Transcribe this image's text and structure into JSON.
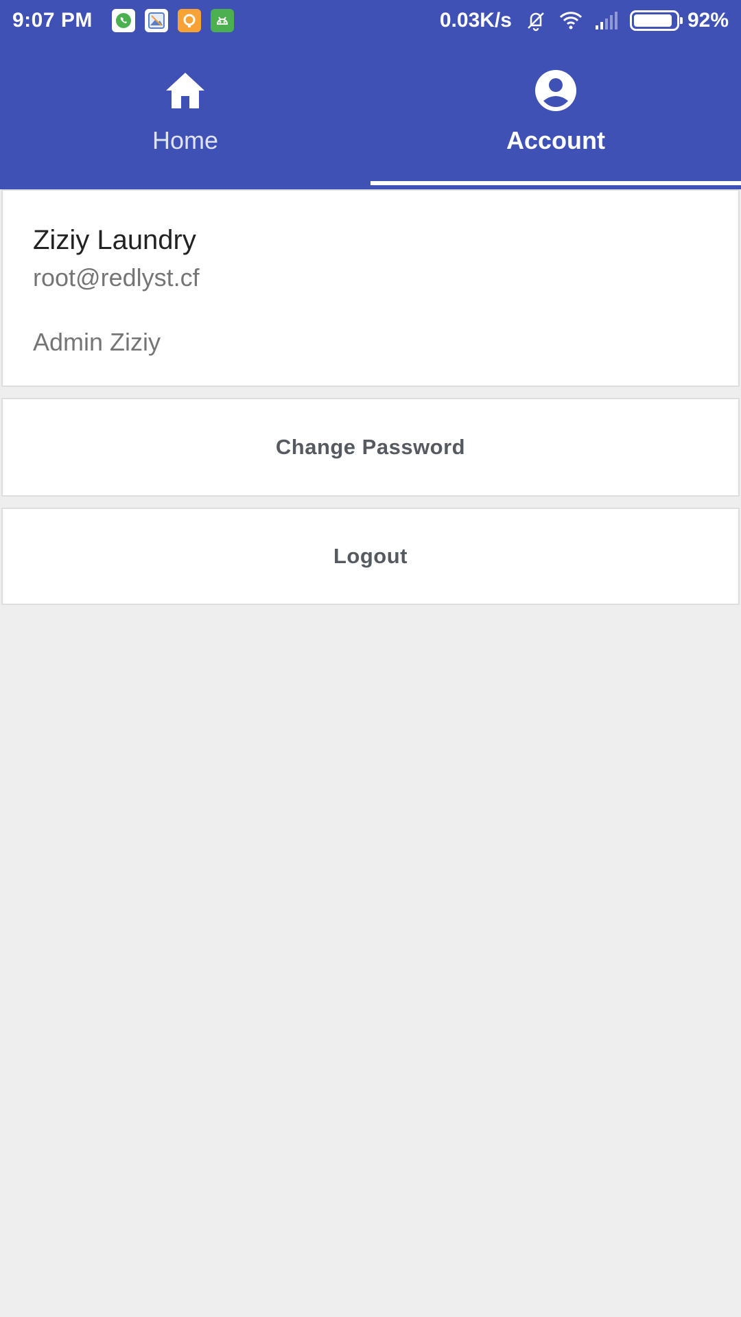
{
  "status_bar": {
    "time": "9:07 PM",
    "network_speed": "0.03K/s",
    "battery_percent": "92%",
    "battery_level": 0.92,
    "notification_icons": [
      "whatsapp-icon",
      "gallery-icon",
      "orange-app-icon",
      "android-app-icon"
    ],
    "right_icons": [
      "vibrate-icon",
      "wifi-icon",
      "signal-icon",
      "battery-icon"
    ]
  },
  "tabs": [
    {
      "label": "Home",
      "icon": "home-icon",
      "active": false
    },
    {
      "label": "Account",
      "icon": "account-circle-icon",
      "active": true
    }
  ],
  "profile": {
    "name": "Ziziy Laundry",
    "email": "root@redlyst.cf",
    "role": "Admin Ziziy"
  },
  "actions": {
    "change_password": "Change Password",
    "logout": "Logout"
  },
  "colors": {
    "primary": "#3f51b5",
    "background": "#eeeeee",
    "card": "#ffffff",
    "secondary_text": "#757575"
  }
}
